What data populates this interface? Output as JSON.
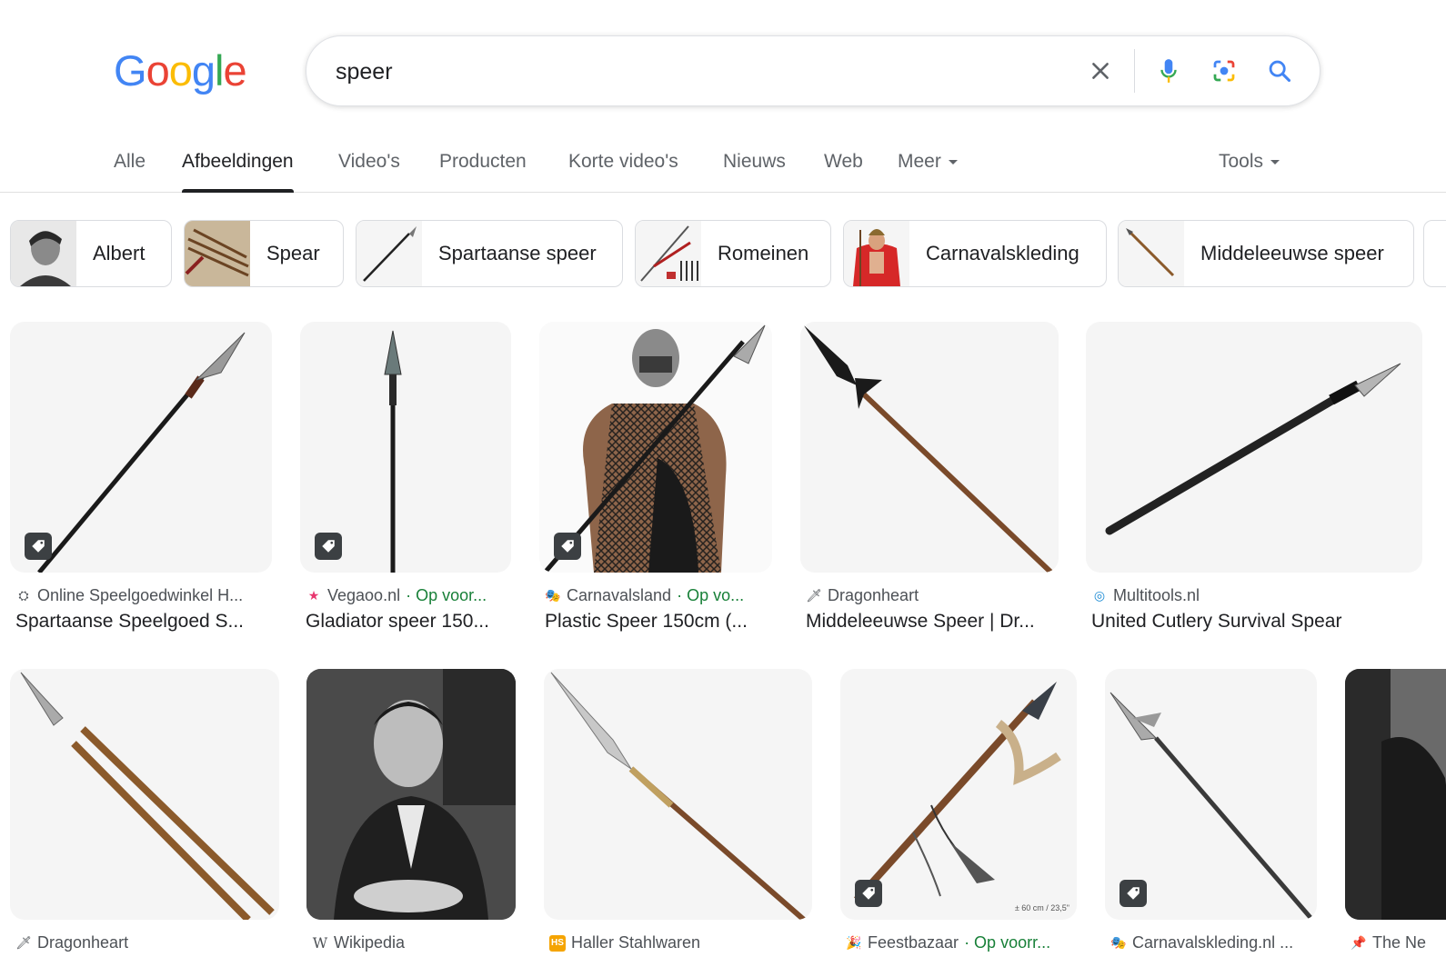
{
  "logo": {
    "g1": "G",
    "o1": "o",
    "o2": "o",
    "g2": "g",
    "l": "l",
    "e": "e"
  },
  "search": {
    "value": "speer",
    "placeholder": ""
  },
  "tabs": [
    "Alle",
    "Afbeeldingen",
    "Video's",
    "Producten",
    "Korte video's",
    "Nieuws",
    "Web",
    "Meer"
  ],
  "tools_label": "Tools",
  "chips": [
    "Albert",
    "Spear",
    "Spartaanse speer",
    "Romeinen",
    "Carnavalskleding",
    "Middeleeuwse speer"
  ],
  "results_row1": [
    {
      "source": "Online Speelgoedwinkel H...",
      "extra": "",
      "title": "Spartaanse Speelgoed S...",
      "favicon": "shop-icon"
    },
    {
      "source": "Vegaoo.nl",
      "extra": "· Op voor...",
      "title": "Gladiator speer 150...",
      "favicon": "star-icon"
    },
    {
      "source": "Carnavalsland",
      "extra": "· Op vo...",
      "title": "Plastic Speer 150cm (...",
      "favicon": "mask-icon"
    },
    {
      "source": "Dragonheart",
      "extra": "",
      "title": "Middeleeuwse Speer | Dr...",
      "favicon": "sword-icon"
    },
    {
      "source": "Multitools.nl",
      "extra": "",
      "title": "United Cutlery Survival Spear",
      "favicon": "target-icon"
    }
  ],
  "results_row2": [
    {
      "source": "Dragonheart",
      "extra": "",
      "favicon": "sword-icon"
    },
    {
      "source": "Wikipedia",
      "extra": "",
      "favicon": "wikipedia-icon"
    },
    {
      "source": "Haller Stahlwaren",
      "extra": "",
      "favicon": "hs-icon"
    },
    {
      "source": "Feestbazaar",
      "extra": "· Op voorr...",
      "favicon": "party-icon"
    },
    {
      "source": "Carnavalskleding.nl ...",
      "extra": "",
      "favicon": "mask-icon"
    },
    {
      "source": "The Ne",
      "extra": "",
      "favicon": "pin-icon"
    }
  ],
  "image_caption": "± 60 cm / 23,5\"",
  "colors": {
    "blue": "#4285F4",
    "red": "#EA4335",
    "yellow": "#FBBC05",
    "green": "#34A853",
    "source_green": "#188038"
  }
}
